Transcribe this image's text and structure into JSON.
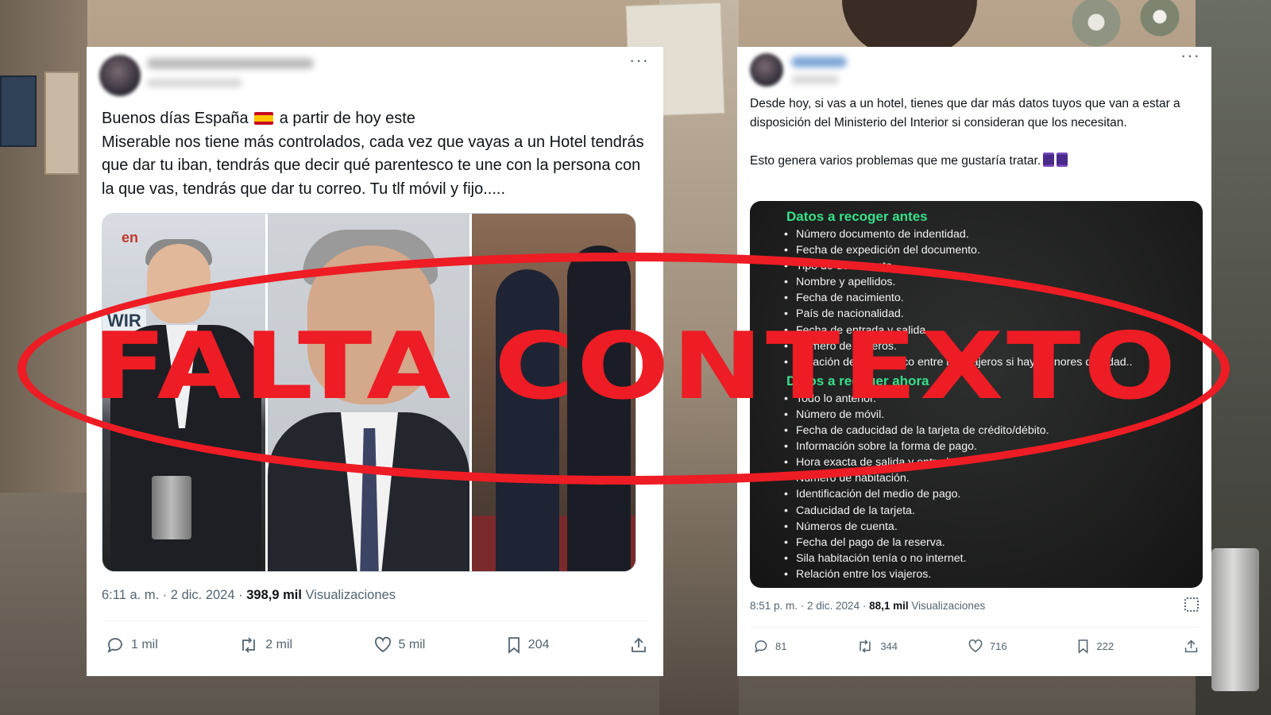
{
  "overlay": {
    "stamp_text": "FALTA CONTEXTO",
    "stamp_color": "#ee1c24"
  },
  "tweet_left": {
    "text_before_flag": "Buenos días España",
    "text_after_flag": " a partir de hoy este\nMiserable nos tiene más controlados, cada vez que vayas a un Hotel tendrás que dar tu iban, tendrás que decir qué parentesco te une con la persona con la que vas, tendrás que dar tu correo. Tu tlf móvil y fijo.....",
    "flag_icon": "spain-flag-emoji",
    "time": "6:11 a. m. · 2 dic. 2024 ·",
    "views_count": "398,9 mil",
    "views_label": "Visualizaciones",
    "replies": "1 mil",
    "reposts": "2 mil",
    "likes": "5 mil",
    "bookmarks": "204"
  },
  "tweet_right": {
    "text": "Desde hoy, si vas a un hotel, tienes que dar más datos tuyos que van a estar a disposición del Ministerio del Interior si consideran que los necesitan.\n\nEsto genera varios problemas que me gustaría tratar.",
    "thread_icon": "spool-emoji",
    "info_image": {
      "title_before": "Datos a recoger antes",
      "items_before": [
        "Número documento de indentidad.",
        "Fecha de expedición del documento.",
        "Tipo de documento.",
        "Nombre y apellidos.",
        "Fecha de nacimiento.",
        "País de nacionalidad.",
        "Fecha de entrada y salida.",
        "Número de viajeros.",
        "Relación de parentesco entre los viajeros si hay menores de edad.."
      ],
      "title_now": "Datos a recoger ahora",
      "items_now": [
        "Todo lo anterior.",
        "Número de móvil.",
        "Fecha de caducidad de la tarjeta de crédito/débito.",
        "Información sobre la forma de pago.",
        "Hora exacta de salida y entrada.",
        "Número de habitación.",
        "Identificación del medio de pago.",
        "Caducidad de la tarjeta.",
        "Números de cuenta.",
        "Fecha del pago de la reserva.",
        "Sila habitación tenía o no internet.",
        "Relación entre los viajeros."
      ]
    },
    "time": "8:51 p. m. · 2 dic. 2024 ·",
    "views_count": "88,1 mil",
    "views_label": "Visualizaciones",
    "replies": "81",
    "reposts": "344",
    "likes": "716",
    "bookmarks": "222"
  }
}
